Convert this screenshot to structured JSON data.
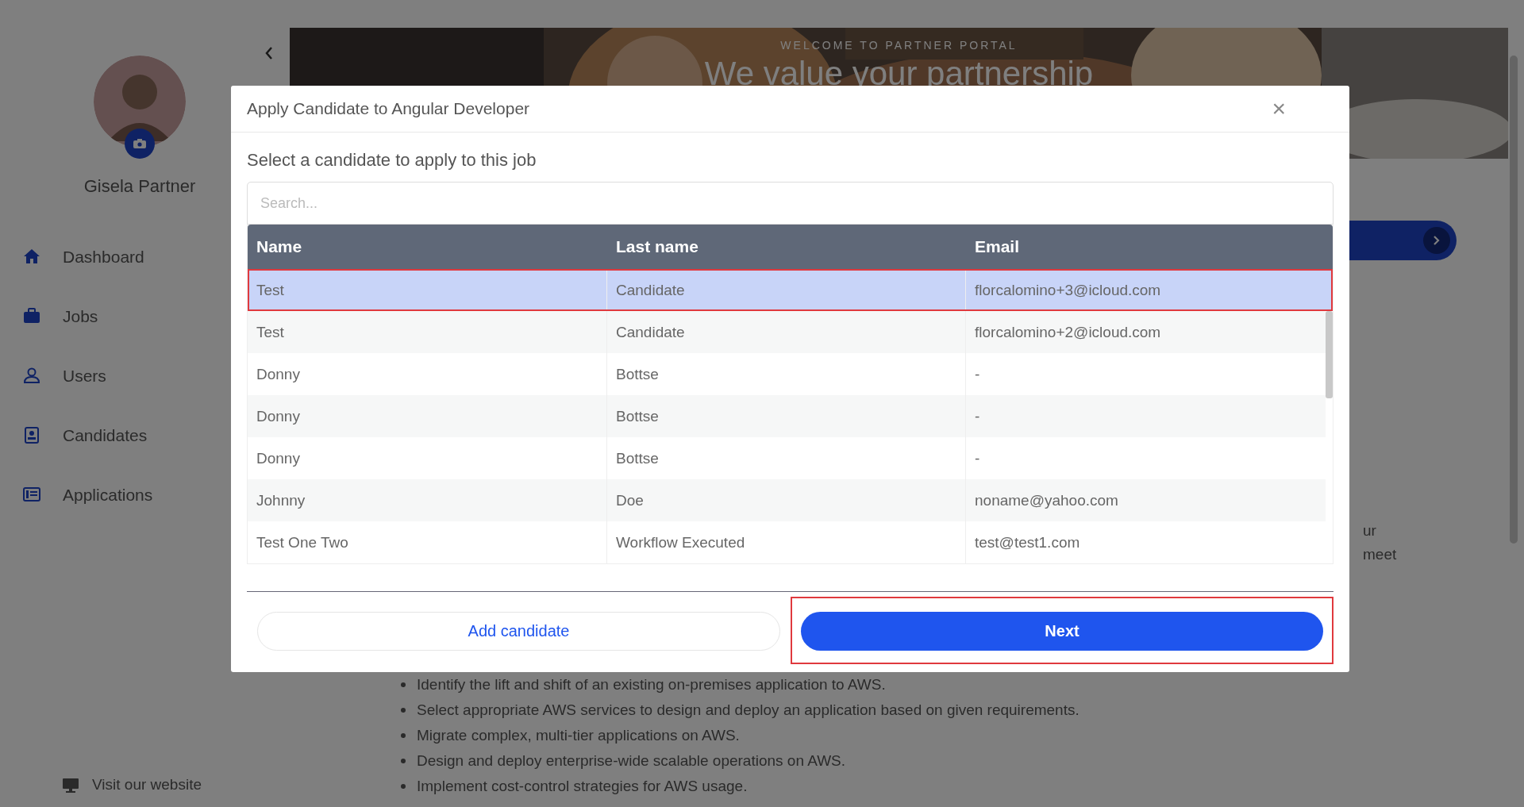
{
  "sidebar": {
    "user_name": "Gisela Partner",
    "items": [
      {
        "label": "Dashboard"
      },
      {
        "label": "Jobs"
      },
      {
        "label": "Users"
      },
      {
        "label": "Candidates"
      },
      {
        "label": "Applications"
      }
    ],
    "footer_link": "Visit our website"
  },
  "banner": {
    "eyebrow": "WELCOME TO PARTNER PORTAL",
    "headline": "We value your partnership"
  },
  "background_fragments": [
    "ur",
    "meet"
  ],
  "bullets": [
    "Identify the lift and shift of an existing on-premises application to AWS.",
    "Select appropriate AWS services to design and deploy an application based on given requirements.",
    "Migrate complex, multi-tier applications on AWS.",
    "Design and deploy enterprise-wide scalable operations on AWS.",
    "Implement cost-control strategies for AWS usage."
  ],
  "modal": {
    "title": "Apply Candidate to Angular Developer",
    "close": "×",
    "prompt": "Select a candidate to apply to this job",
    "search": {
      "placeholder": "Search..."
    },
    "table": {
      "columns": [
        "Name",
        "Last name",
        "Email"
      ],
      "rows": [
        {
          "cells": [
            "Test",
            "Candidate",
            "florcalomino+3@icloud.com"
          ],
          "selected": true
        },
        {
          "cells": [
            "Test",
            "Candidate",
            "florcalomino+2@icloud.com"
          ],
          "selected": false
        },
        {
          "cells": [
            "Donny",
            "Bottse",
            "-"
          ],
          "selected": false
        },
        {
          "cells": [
            "Donny",
            "Bottse",
            "-"
          ],
          "selected": false
        },
        {
          "cells": [
            "Donny",
            "Bottse",
            "-"
          ],
          "selected": false
        },
        {
          "cells": [
            "Johnny",
            "Doe",
            "noname@yahoo.com"
          ],
          "selected": false
        },
        {
          "cells": [
            "Test One Two",
            "Workflow Executed",
            "test@test1.com"
          ],
          "selected": false
        }
      ]
    },
    "buttons": [
      {
        "label": "Add candidate",
        "kind": "secondary",
        "highlighted": false
      },
      {
        "label": "Next",
        "kind": "primary",
        "highlighted": true
      }
    ]
  }
}
